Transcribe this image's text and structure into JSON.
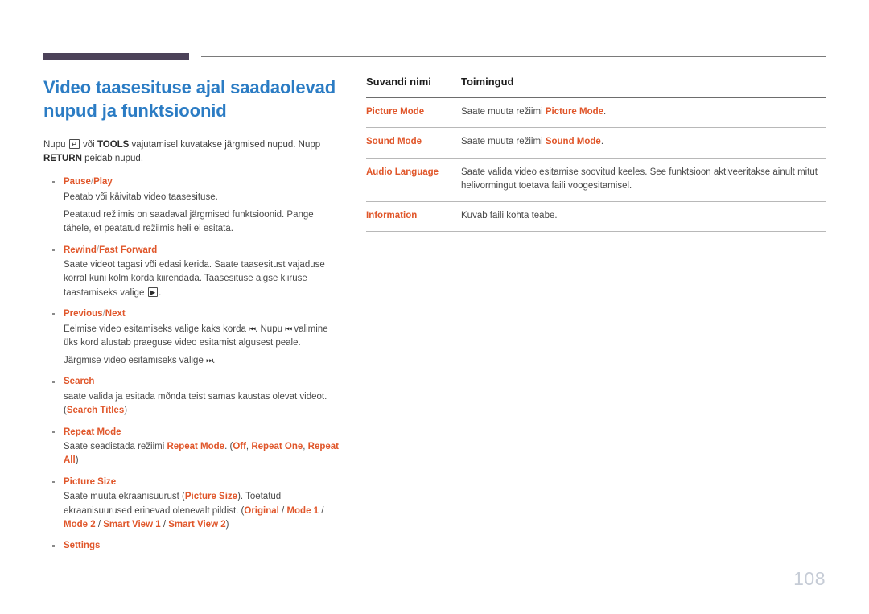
{
  "document": {
    "page_number": "108",
    "accent_color": "#e0562a",
    "title_color": "#2b7cc4",
    "rule_color": "#4c4259"
  },
  "left_column": {
    "title": "Video taasesituse ajal saadaolevad nupud ja funktsioonid",
    "intro": {
      "part1": "Nupu",
      "icon_return": "↵",
      "part2": "või",
      "bold_tools": "TOOLS",
      "part3": "vajutamisel kuvatakse järgmised nupud. Nupp",
      "bold_return": "RETURN",
      "part4": "peidab nupud."
    },
    "items": [
      {
        "head_a": "Pause",
        "head_sep": "/",
        "head_b": "Play",
        "paras": [
          "Peatab või käivitab video taasesituse.",
          "Peatatud režiimis on saadaval järgmised funktsioonid. Pange tähele, et peatatud režiimis heli ei esitata."
        ]
      },
      {
        "head_a": "Rewind",
        "head_sep": "/",
        "head_b": "Fast Forward",
        "para_pre": "Saate videot tagasi või edasi kerida. Saate taasesitust vajaduse korral kuni kolm korda kiirendada. Taasesituse algse kiiruse taastamiseks valige",
        "icon": "▶",
        "para_post": "."
      },
      {
        "head_a": "Previous",
        "head_sep": "/",
        "head_b": "Next",
        "p1_pre": "Eelmise video esitamiseks valige kaks korda",
        "p1_icon": "⏮",
        "p1_mid": ". Nupu",
        "p1_icon2": "⏮",
        "p1_post": "valimine üks kord alustab praeguse video esitamist algusest peale.",
        "p2_pre": "Järgmise video esitamiseks valige",
        "p2_icon": "⏭",
        "p2_post": "."
      },
      {
        "head_a": "Search",
        "p_pre": "saate valida ja esitada mõnda teist samas kaustas olevat videot. (",
        "p_hl": "Search Titles",
        "p_post": ")"
      },
      {
        "head_a": "Repeat Mode",
        "p_pre": "Saate seadistada režiimi",
        "p_hl1": "Repeat Mode",
        "p_mid1": ". (",
        "p_hl2": "Off",
        "p_mid2": ",",
        "p_hl3": "Repeat One",
        "p_mid3": ",",
        "p_hl4": "Repeat All",
        "p_post": ")"
      },
      {
        "head_a": "Picture Size",
        "p_pre": "Saate muuta ekraanisuurust (",
        "p_hl1": "Picture Size",
        "p_mid1": "). Toetatud ekraanisuurused erinevad olenevalt pildist. (",
        "p_hl2": "Original",
        "p_sep1": "/",
        "p_hl3": "Mode 1",
        "p_sep2": "/",
        "p_hl4": "Mode 2",
        "p_sep3": "/",
        "p_hl5": "Smart View 1",
        "p_sep4": "/",
        "p_hl6": "Smart View 2",
        "p_post": ")"
      },
      {
        "head_a": "Settings"
      }
    ]
  },
  "right_column": {
    "table": {
      "headers": [
        "Suvandi nimi",
        "Toimingud"
      ],
      "rows": [
        {
          "name": "Picture Mode",
          "action_pre": "Saate muuta režiimi",
          "action_hl": "Picture Mode",
          "action_post": "."
        },
        {
          "name": "Sound Mode",
          "action_pre": "Saate muuta režiimi",
          "action_hl": "Sound Mode",
          "action_post": "."
        },
        {
          "name": "Audio Language",
          "action_pre": "Saate valida video esitamise soovitud keeles. See funktsioon aktiveeritakse ainult mitut helivormingut toetava faili voogesitamisel.",
          "action_hl": "",
          "action_post": ""
        },
        {
          "name": "Information",
          "action_pre": "Kuvab faili kohta teabe.",
          "action_hl": "",
          "action_post": ""
        }
      ]
    }
  }
}
